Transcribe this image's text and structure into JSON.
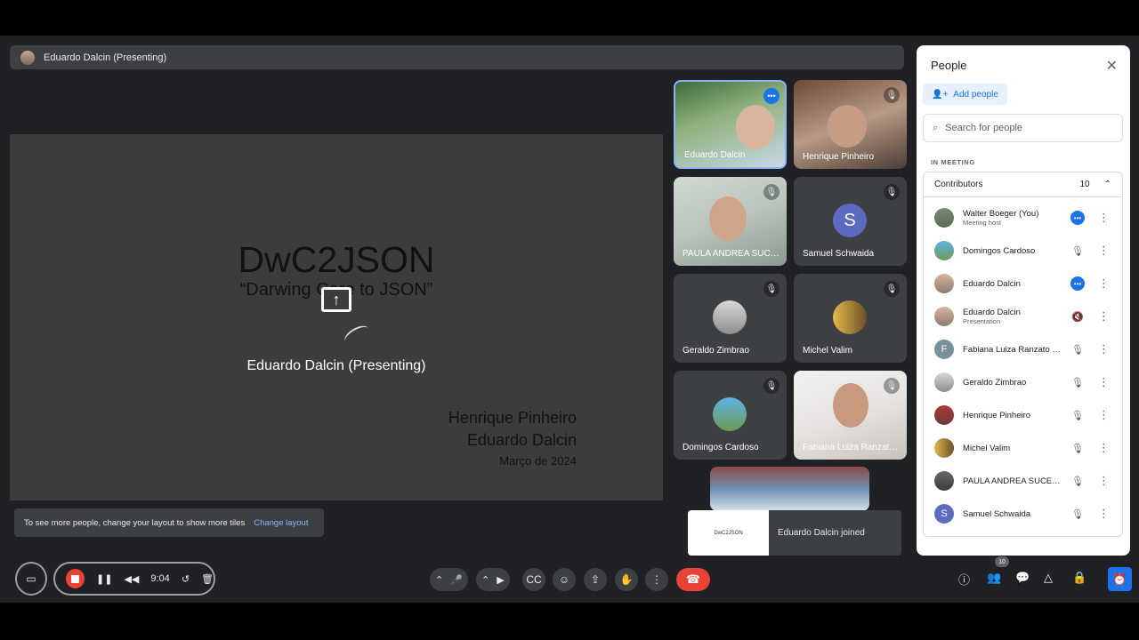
{
  "present_bar": {
    "label": "Eduardo Dalcin (Presenting)"
  },
  "slide": {
    "title": "DwC2JSON",
    "subtitle": "“Darwing Core to JSON”",
    "presenting_label": "Eduardo Dalcin (Presenting)",
    "author1": "Henrique Pinheiro",
    "author2": "Eduardo Dalcin",
    "date": "Março de 2024"
  },
  "tiles": [
    {
      "name": "Eduardo Dalcin"
    },
    {
      "name": "Henrique Pinheiro"
    },
    {
      "name": "PAULA ANDREA SUCE..."
    },
    {
      "name": "Samuel Schwaida",
      "letter": "S"
    },
    {
      "name": "Geraldo Zimbrao"
    },
    {
      "name": "Michel Valim"
    },
    {
      "name": "Domingos Cardoso"
    },
    {
      "name": "Fabiana Luiza Ranzato..."
    }
  ],
  "toast": {
    "thumb_text": "DwC2JSON",
    "message": "Eduardo Dalcin joined"
  },
  "snackbar": {
    "message": "To see more people, change your layout to show more tiles",
    "link": "Change layout"
  },
  "people_panel": {
    "title": "People",
    "add_people": "Add people",
    "search_placeholder": "Search for people",
    "section": "IN MEETING",
    "group_label": "Contributors",
    "group_count": "10",
    "people": [
      {
        "name": "Walter Boeger (You)",
        "sub": "Meeting host"
      },
      {
        "name": "Domingos Cardoso",
        "sub": ""
      },
      {
        "name": "Eduardo Dalcin",
        "sub": ""
      },
      {
        "name": "Eduardo Dalcin",
        "sub": "Presentation"
      },
      {
        "name": "Fabiana Luiza Ranzato Fil...",
        "sub": "",
        "letter": "F"
      },
      {
        "name": "Geraldo Zimbrao",
        "sub": ""
      },
      {
        "name": "Henrique Pinheiro",
        "sub": ""
      },
      {
        "name": "Michel Valim",
        "sub": ""
      },
      {
        "name": "PAULA ANDREA SUCERQ...",
        "sub": ""
      },
      {
        "name": "Samuel Schwaida",
        "sub": "",
        "letter": "S"
      }
    ]
  },
  "toolbar": {
    "timer": "9:04",
    "participant_badge": "10"
  },
  "colors": {
    "accent": "#1a73e8",
    "hangup": "#ea4335",
    "background": "#202124"
  }
}
